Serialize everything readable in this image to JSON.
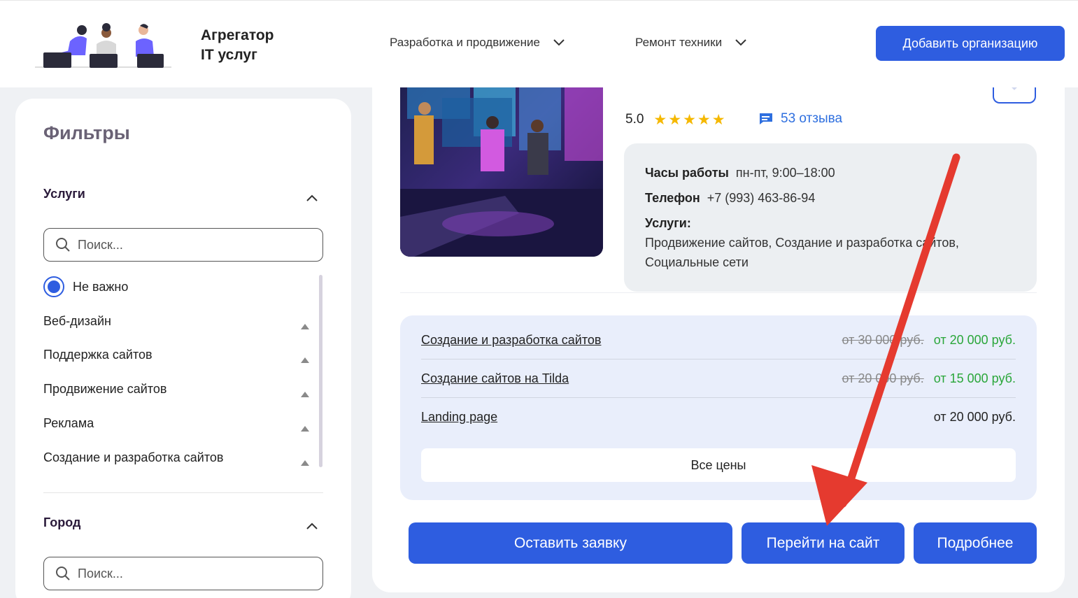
{
  "header": {
    "logo_line1": "Агрегатор",
    "logo_line2": "IT услуг",
    "nav": [
      {
        "label": "Разработка и продвижение"
      },
      {
        "label": "Ремонт техники"
      }
    ],
    "add_button": "Добавить организацию"
  },
  "sidebar": {
    "title": "Фильтры",
    "services_title": "Услуги",
    "search_placeholder": "Поиск...",
    "radio_label": "Не важно",
    "services": [
      {
        "label": "Веб-дизайн"
      },
      {
        "label": "Поддержка сайтов"
      },
      {
        "label": "Продвижение сайтов"
      },
      {
        "label": "Реклама"
      },
      {
        "label": "Создание и разработка сайтов"
      }
    ],
    "city_title": "Город",
    "city_search_placeholder": "Поиск..."
  },
  "card": {
    "rating": "5.0",
    "stars_filled": 5,
    "reviews": "53 отзыва",
    "hours_label": "Часы работы",
    "hours_value": "пн-пт, 9:00–18:00",
    "phone_label": "Телефон",
    "phone_value": "+7 (993) 463-86-94",
    "services_label": "Услуги:",
    "services_line1": "Продвижение сайтов, Создание и разработка сайтов,",
    "services_line2": "Социальные сети",
    "prices": [
      {
        "name": "Создание и разработка сайтов",
        "old": "от 30 000 руб.",
        "new": "от 20 000 руб."
      },
      {
        "name": "Создание сайтов на Tilda",
        "old": "от 20 000 руб.",
        "new": "от 15 000 руб."
      },
      {
        "name": "Landing page",
        "price": "от 20 000 руб."
      }
    ],
    "all_prices": "Все цены",
    "btn_request": "Оставить заявку",
    "btn_site": "Перейти на сайт",
    "btn_more": "Подробнее"
  },
  "colors": {
    "accent": "#2e5de0",
    "price_new": "#2aa63a",
    "annotation_arrow": "#e53a2f"
  }
}
